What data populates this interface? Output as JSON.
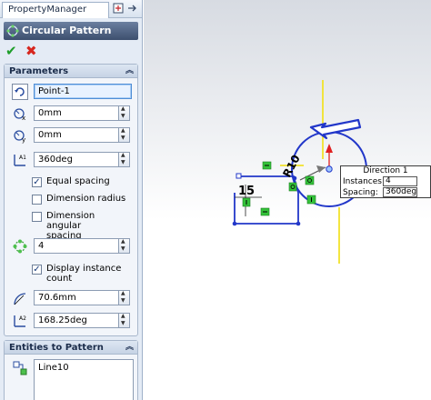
{
  "property_manager": {
    "tab_label": "PropertyManager",
    "feature_title": "Circular Pattern"
  },
  "parameters": {
    "header": "Parameters",
    "center_point": "Point-1",
    "center_x": "0mm",
    "center_y": "0mm",
    "angle": "360deg",
    "equal_spacing_label": "Equal spacing",
    "equal_spacing_checked": true,
    "dimension_radius_label": "Dimension radius",
    "dimension_radius_checked": false,
    "dimension_angular_label_line1": "Dimension angular",
    "dimension_angular_label_line2": "spacing",
    "dimension_angular_checked": false,
    "instances": "4",
    "display_instance_count_line1": "Display instance",
    "display_instance_count_line2": "count",
    "display_instance_count_checked": true,
    "radius": "70.6mm",
    "arc_angle": "168.25deg"
  },
  "entities": {
    "header": "Entities to Pattern",
    "items": [
      "Line10"
    ]
  },
  "graphics": {
    "dim_15": "15",
    "dim_r10": "R10",
    "callout": {
      "title": "Direction 1",
      "instances_label": "Instances:",
      "instances_value": "4",
      "spacing_label": "Spacing:",
      "spacing_value": "360deg"
    }
  },
  "colors": {
    "accent_blue": "#2237c9",
    "axis_yellow": "#f2e22a",
    "relation_green": "#34c23a",
    "arrow_red": "#e02020"
  }
}
